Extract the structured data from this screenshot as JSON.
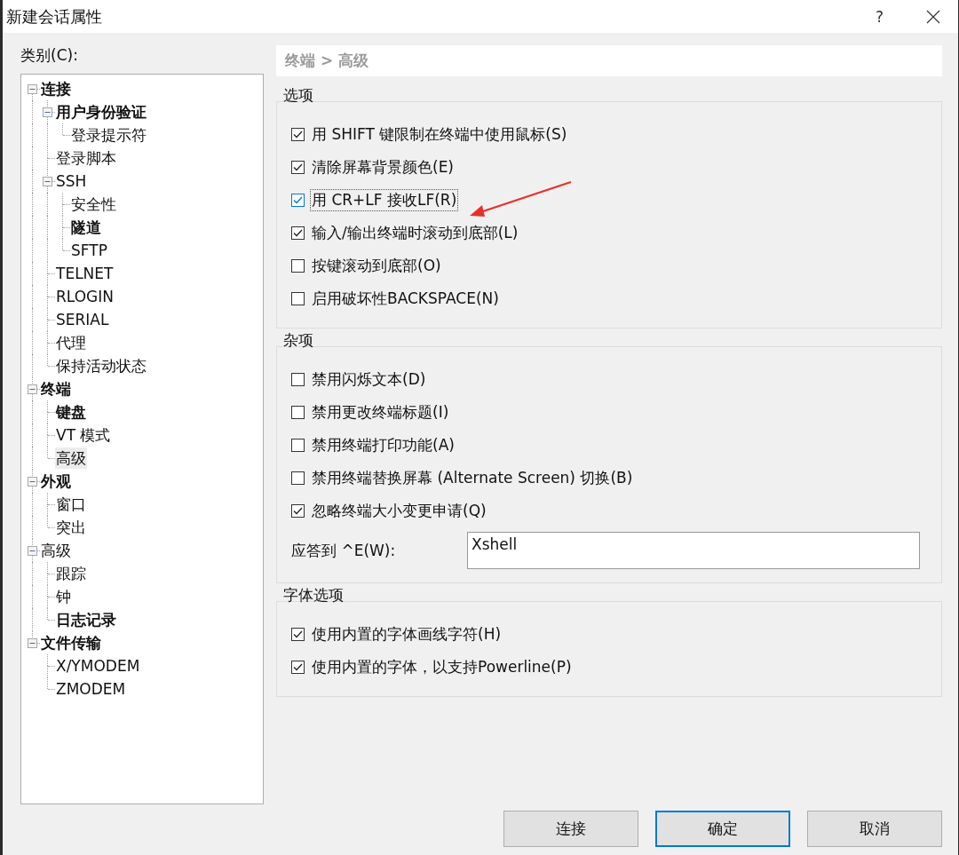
{
  "window": {
    "title": "新建会话属性",
    "help": "?"
  },
  "category_label": "类别(C):",
  "tree": [
    {
      "label": "连接",
      "bold": true,
      "selected": false,
      "expanded": true,
      "children": [
        {
          "label": "用户身份验证",
          "bold": true,
          "selected": false,
          "expanded": true,
          "children": [
            {
              "label": "登录提示符",
              "bold": false,
              "selected": false
            }
          ]
        },
        {
          "label": "登录脚本",
          "bold": false,
          "selected": false
        },
        {
          "label": "SSH",
          "bold": false,
          "selected": false,
          "expanded": true,
          "children": [
            {
              "label": "安全性",
              "bold": false,
              "selected": false
            },
            {
              "label": "隧道",
              "bold": true,
              "selected": false
            },
            {
              "label": "SFTP",
              "bold": false,
              "selected": false
            }
          ]
        },
        {
          "label": "TELNET",
          "bold": false,
          "selected": false
        },
        {
          "label": "RLOGIN",
          "bold": false,
          "selected": false
        },
        {
          "label": "SERIAL",
          "bold": false,
          "selected": false
        },
        {
          "label": "代理",
          "bold": false,
          "selected": false
        },
        {
          "label": "保持活动状态",
          "bold": false,
          "selected": false
        }
      ]
    },
    {
      "label": "终端",
      "bold": true,
      "selected": false,
      "expanded": true,
      "children": [
        {
          "label": "键盘",
          "bold": true,
          "selected": false
        },
        {
          "label": "VT 模式",
          "bold": false,
          "selected": false
        },
        {
          "label": "高级",
          "bold": false,
          "selected": true
        }
      ]
    },
    {
      "label": "外观",
      "bold": true,
      "selected": false,
      "expanded": true,
      "children": [
        {
          "label": "窗口",
          "bold": false,
          "selected": false
        },
        {
          "label": "突出",
          "bold": false,
          "selected": false
        }
      ]
    },
    {
      "label": "高级",
      "bold": false,
      "selected": false,
      "expanded": true,
      "children": [
        {
          "label": "跟踪",
          "bold": false,
          "selected": false
        },
        {
          "label": "钟",
          "bold": false,
          "selected": false
        },
        {
          "label": "日志记录",
          "bold": true,
          "selected": false
        }
      ]
    },
    {
      "label": "文件传输",
      "bold": true,
      "selected": false,
      "expanded": true,
      "children": [
        {
          "label": "X/YMODEM",
          "bold": false,
          "selected": false
        },
        {
          "label": "ZMODEM",
          "bold": false,
          "selected": false
        }
      ]
    }
  ],
  "breadcrumb": "终端 > 高级",
  "groups": [
    {
      "title": "选项",
      "options": [
        {
          "label": "用 SHIFT 键限制在终端中使用鼠标(S)",
          "checked": true,
          "focused": false
        },
        {
          "label": "清除屏幕背景颜色(E)",
          "checked": true,
          "focused": false
        },
        {
          "label": "用 CR+LF 接收LF(R)",
          "checked": true,
          "focused": true
        },
        {
          "label": "输入/输出终端时滚动到底部(L)",
          "checked": true,
          "focused": false
        },
        {
          "label": "按键滚动到底部(O)",
          "checked": false,
          "focused": false
        },
        {
          "label": "启用破坏性BACKSPACE(N)",
          "checked": false,
          "focused": false
        }
      ]
    },
    {
      "title": "杂项",
      "options": [
        {
          "label": "禁用闪烁文本(D)",
          "checked": false,
          "focused": false
        },
        {
          "label": "禁用更改终端标题(I)",
          "checked": false,
          "focused": false
        },
        {
          "label": "禁用终端打印功能(A)",
          "checked": false,
          "focused": false
        },
        {
          "label": "禁用终端替换屏幕 (Alternate Screen) 切换(B)",
          "checked": false,
          "focused": false
        },
        {
          "label": "忽略终端大小变更申请(Q)",
          "checked": true,
          "focused": false
        }
      ],
      "field": {
        "label": "应答到 ^E(W):",
        "value": "Xshell"
      }
    },
    {
      "title": "字体选项",
      "options": [
        {
          "label": "使用内置的字体画线字符(H)",
          "checked": true,
          "focused": false
        },
        {
          "label": "使用内置的字体，以支持Powerline(P)",
          "checked": true,
          "focused": false
        }
      ]
    }
  ],
  "buttons": [
    {
      "label": "连接",
      "default": false
    },
    {
      "label": "确定",
      "default": true
    },
    {
      "label": "取消",
      "default": false
    }
  ]
}
